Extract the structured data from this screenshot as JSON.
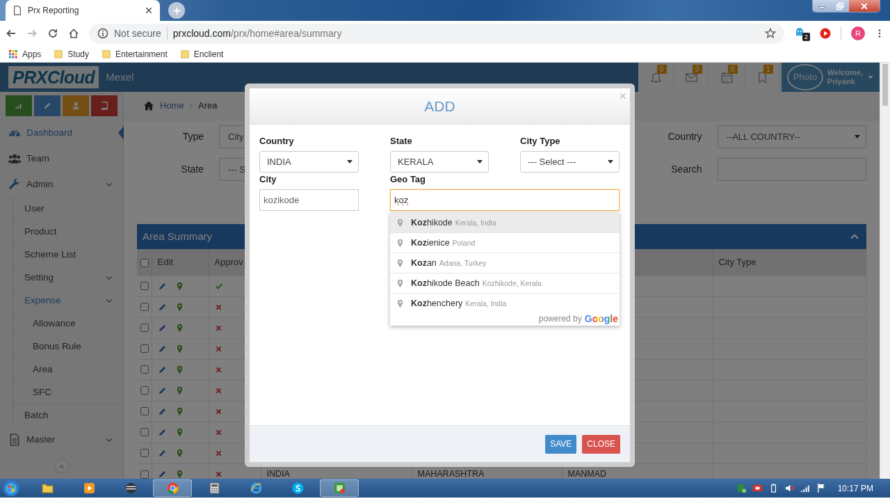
{
  "browser": {
    "tab_title": "Prx Reporting",
    "security": "Not secure",
    "url_host": "prxcloud.com",
    "url_path": "/prx/home#area/summary",
    "extension_badge": "2",
    "profile_initial": "R",
    "bookmarks": [
      "Apps",
      "Study",
      "Entertainment",
      "Enclient"
    ]
  },
  "header": {
    "brand": "PRXCloud",
    "company": "Mexel",
    "notifications": [
      {
        "count": "0"
      },
      {
        "count": "0"
      },
      {
        "count": "0"
      },
      {
        "count": "1"
      }
    ],
    "user": {
      "photo_alt": "Photo",
      "greeting": "Welcome,",
      "name": "Priyank"
    }
  },
  "sidebar": {
    "items": [
      {
        "label": "Dashboard",
        "highlighted": true,
        "submenu": false
      },
      {
        "label": "Team",
        "highlighted": false,
        "submenu": false
      },
      {
        "label": "Admin",
        "highlighted": false,
        "submenu": true,
        "children": [
          {
            "label": "User",
            "highlighted": false,
            "submenu": false
          },
          {
            "label": "Product",
            "highlighted": false,
            "submenu": false
          },
          {
            "label": "Scheme List",
            "highlighted": false,
            "submenu": false
          },
          {
            "label": "Setting",
            "highlighted": false,
            "submenu": true
          },
          {
            "label": "Expense",
            "highlighted": true,
            "submenu": true,
            "children": [
              {
                "label": "Allowance",
                "highlighted": false,
                "submenu": false
              },
              {
                "label": "Bonus Rule",
                "highlighted": false,
                "submenu": false
              },
              {
                "label": "Area",
                "highlighted": false,
                "submenu": false
              },
              {
                "label": "SFC",
                "highlighted": false,
                "submenu": false
              }
            ]
          },
          {
            "label": "Batch",
            "highlighted": false,
            "submenu": false
          }
        ]
      },
      {
        "label": "Master",
        "highlighted": false,
        "submenu": true
      }
    ],
    "collapse": "«"
  },
  "breadcrumb": {
    "items": [
      "Home",
      "Area"
    ],
    "separator": "›"
  },
  "filters": [
    {
      "label": "Type",
      "kind": "select",
      "value": "City"
    },
    {
      "label": "Country",
      "kind": "select",
      "value": "--ALL COUNTRY--"
    },
    {
      "label": "State",
      "kind": "select",
      "value": "--- S"
    },
    {
      "label": "Search",
      "kind": "input"
    }
  ],
  "table": {
    "title": "Area Summary",
    "header_checked": false,
    "columns": [
      "Edit",
      "Approv",
      "",
      "",
      "",
      "City Type"
    ],
    "rows": [
      {
        "checked": false,
        "approved": true
      },
      {
        "checked": false,
        "approved": false
      },
      {
        "checked": false,
        "approved": false
      },
      {
        "checked": false,
        "approved": false
      },
      {
        "checked": false,
        "approved": false
      },
      {
        "checked": false,
        "approved": false
      },
      {
        "checked": false,
        "approved": false
      },
      {
        "checked": false,
        "approved": false
      },
      {
        "checked": false,
        "approved": false
      },
      {
        "checked": false,
        "approved": false,
        "country": "INDIA",
        "state": "MAHARASHTRA",
        "city": "MANMAD"
      }
    ]
  },
  "modal": {
    "title": "ADD",
    "close": "×",
    "fields": [
      {
        "label": "Country",
        "kind": "select",
        "value": "INDIA",
        "focused": false
      },
      {
        "label": "State",
        "kind": "select",
        "value": "KERALA",
        "focused": false
      },
      {
        "label": "City Type",
        "kind": "select",
        "value": "--- Select ---",
        "focused": false
      },
      {
        "label": "City",
        "kind": "input",
        "value": "kozikode",
        "focused": false
      },
      {
        "label": "Geo Tag",
        "kind": "input",
        "value": "koz",
        "focused": true
      }
    ],
    "suggestions": [
      {
        "main": "**Koz**hikode",
        "secondary": "Kerala, India",
        "highlighted": true
      },
      {
        "main": "**Koz**ienice",
        "secondary": "Poland",
        "highlighted": false
      },
      {
        "main": "**Koz**an",
        "secondary": "Adana, Turkey",
        "highlighted": false
      },
      {
        "main": "**Koz**hikode Beach",
        "secondary": "Kozhikode, Kerala",
        "highlighted": false
      },
      {
        "main": "**Koz**henchery",
        "secondary": "Kerala, India",
        "highlighted": false
      }
    ],
    "attribution": {
      "prefix": "powered by",
      "brand": "Google"
    },
    "buttons": [
      {
        "label": "SAVE",
        "kind": "primary"
      },
      {
        "label": "CLOSE",
        "kind": "danger"
      }
    ]
  },
  "taskbar": {
    "clock": "10:17 PM"
  }
}
